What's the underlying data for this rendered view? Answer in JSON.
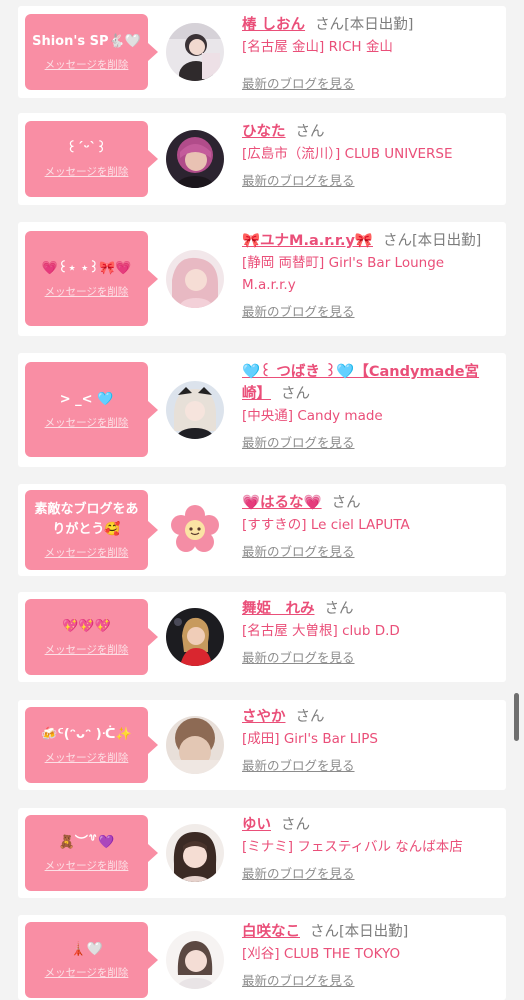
{
  "delete_label": "メッセージを削除",
  "blog_label": "最新のブログを見る",
  "san_label": "さん",
  "colors": {
    "accent_pink": "#f98ea4",
    "name_pink": "#ea4f79",
    "background": "#f3f3f3"
  },
  "items": [
    {
      "message": "Shion's SP🐇🤍",
      "name": "椿 しおん",
      "work": "[本日出勤]",
      "shop": "[名古屋 金山] RICH 金山",
      "avatar_icon": "photo-portrait-icon"
    },
    {
      "message": "꒰ˊᵕˋ꒱",
      "name": "ひなた",
      "work": "",
      "shop": "[広島市（流川）] CLUB UNIVERSE",
      "avatar_icon": "photo-portrait-icon"
    },
    {
      "message": "💗꒰⋆ ⋆꒱🎀💗",
      "name": "🎀ユナM.a.r.r.y🎀",
      "work": "[本日出勤]",
      "shop": "[静岡 両替町] Girl's Bar Lounge M.a.r.r.y",
      "avatar_icon": "photo-portrait-icon"
    },
    {
      "message": "> _< 🩵",
      "name": "🩵꒰ つばき ꒱🩵【Candymade宮崎】",
      "work": "",
      "shop": "[中央通] Candy made",
      "avatar_icon": "photo-portrait-icon"
    },
    {
      "message": "素敵なブログをありがとう🥰",
      "name": "💗はるな💗",
      "work": "",
      "shop": "[すすきの] Le ciel LAPUTA",
      "avatar_icon": "flower-character-icon"
    },
    {
      "message": "💖💖💖",
      "name": "舞姫　れみ",
      "work": "",
      "shop": "[名古屋 大曽根] club D.D",
      "avatar_icon": "photo-portrait-icon"
    },
    {
      "message": "🍻ᑦ(ᵔᴗᵔ )ᑣ✨",
      "name": "さやか",
      "work": "",
      "shop": "[成田] Girl's Bar LIPS",
      "avatar_icon": "photo-portrait-icon"
    },
    {
      "message": "🧸︶꒷💜",
      "name": "ゆい",
      "work": "",
      "shop": "[ミナミ] フェスティバル なんば本店",
      "avatar_icon": "photo-portrait-icon"
    },
    {
      "message": "🗼🤍",
      "name": "白咲なこ",
      "work": "[本日出勤]",
      "shop": "[刈谷] CLUB THE TOKYO",
      "avatar_icon": "photo-portrait-icon"
    }
  ]
}
